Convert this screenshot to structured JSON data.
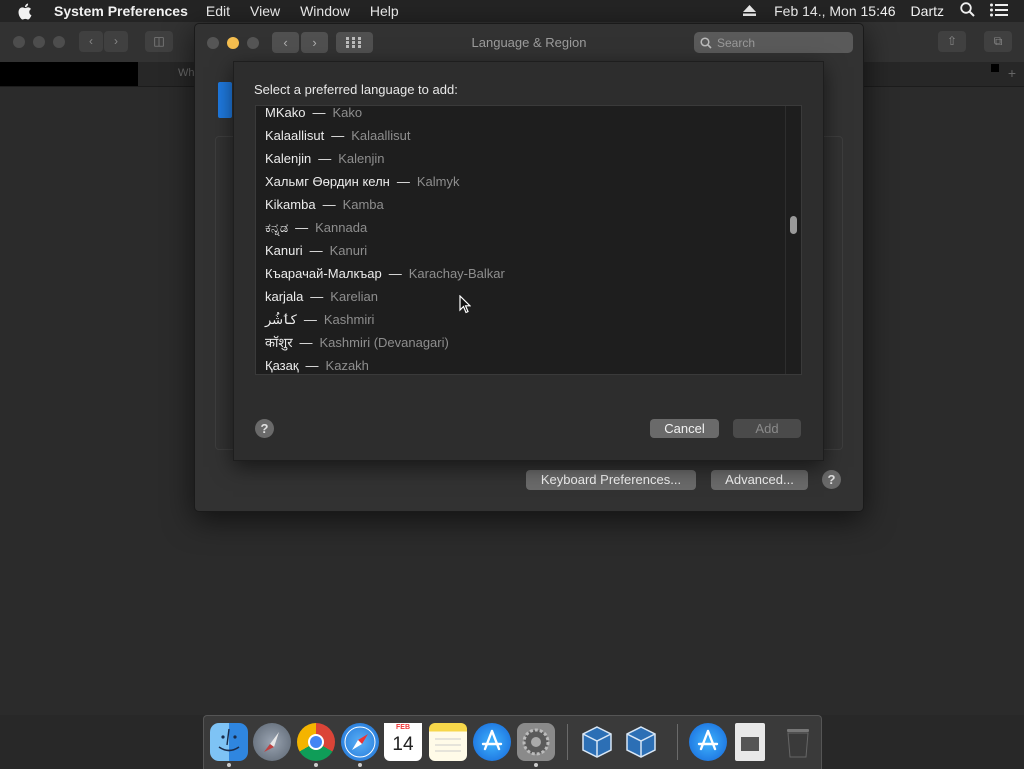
{
  "menubar": {
    "app_name": "System Preferences",
    "items": [
      "Edit",
      "View",
      "Window",
      "Help"
    ],
    "date_time": "Feb 14., Mon  15:46",
    "user": "Dartz"
  },
  "background_window": {
    "tab_text": "Wh"
  },
  "window": {
    "title": "Language & Region",
    "search_placeholder": "Search",
    "keyboard_prefs_label": "Keyboard Preferences...",
    "advanced_label": "Advanced...",
    "help_label": "?"
  },
  "sheet": {
    "heading": "Select a preferred language to add:",
    "languages": [
      {
        "native": "MKako",
        "english": "Kako"
      },
      {
        "native": "Kalaallisut",
        "english": "Kalaallisut"
      },
      {
        "native": "Kalenjin",
        "english": "Kalenjin"
      },
      {
        "native": "Хальмг Өөрдин келн",
        "english": "Kalmyk"
      },
      {
        "native": "Kikamba",
        "english": "Kamba"
      },
      {
        "native": "ಕನ್ನಡ",
        "english": "Kannada"
      },
      {
        "native": "Kanuri",
        "english": "Kanuri"
      },
      {
        "native": "Къарачай-Малкъар",
        "english": "Karachay-Balkar"
      },
      {
        "native": "karjala",
        "english": "Karelian"
      },
      {
        "native": "کٲشُر",
        "english": "Kashmiri"
      },
      {
        "native": "कॉशुर",
        "english": "Kashmiri (Devanagari)"
      },
      {
        "native": "Қазақ",
        "english": "Kazakh"
      }
    ],
    "separator": "—",
    "help_label": "?",
    "cancel_label": "Cancel",
    "add_label": "Add"
  },
  "dock": {
    "apps": [
      "finder",
      "launchpad",
      "chrome",
      "safari",
      "calendar",
      "notes",
      "app-store",
      "system-preferences",
      "virtualbox",
      "virtualbox-vm",
      "app-store-downloads",
      "document",
      "trash"
    ],
    "calendar_day": "14",
    "calendar_month": "FEB"
  },
  "colors": {
    "accent_blue": "#1f7ae0",
    "minimize_yellow": "#f5be4f"
  }
}
